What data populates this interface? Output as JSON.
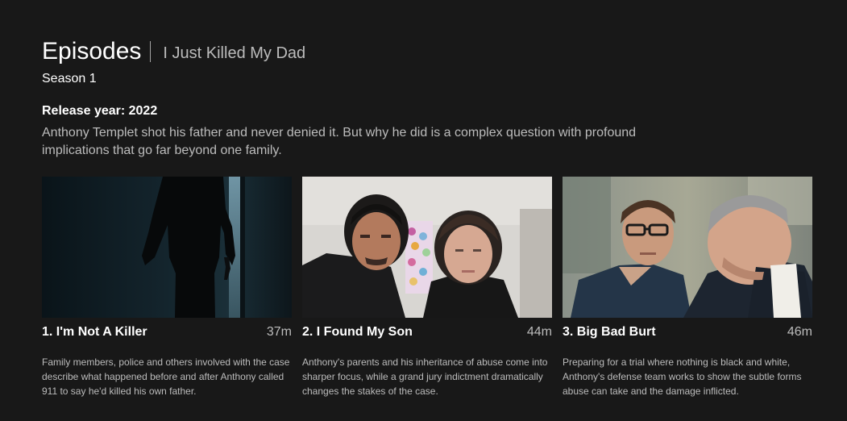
{
  "header": {
    "title": "Episodes",
    "show_name": "I Just Killed My Dad"
  },
  "season": {
    "label": "Season 1"
  },
  "release": {
    "label": "Release year: 2022"
  },
  "synopsis": "Anthony Templet shot his father and never denied it. But why he did is a complex question with profound implications that go far beyond one family.",
  "episodes": [
    {
      "title": "1. I'm Not A Killer",
      "runtime": "37m",
      "description": "Family members, police and others involved with the case describe what happened before and after Anthony called 911 to say he'd killed his own father.",
      "thumbnail": "silhouette-with-gun-still"
    },
    {
      "title": "2. I Found My Son",
      "runtime": "44m",
      "description": "Anthony's parents and his inheritance of abuse come into sharper focus, while a grand jury indictment dramatically changes the stakes of the case.",
      "thumbnail": "couple-family-photo-still"
    },
    {
      "title": "3. Big Bad Burt",
      "runtime": "46m",
      "description": "Preparing for a trial where nothing is black and white, Anthony's defense team works to show the subtle forms abuse can take and the damage inflicted.",
      "thumbnail": "young-man-and-lawyer-still"
    }
  ],
  "colors": {
    "background": "#181818",
    "text_primary": "#ffffff",
    "text_secondary": "#bcbcbc"
  }
}
